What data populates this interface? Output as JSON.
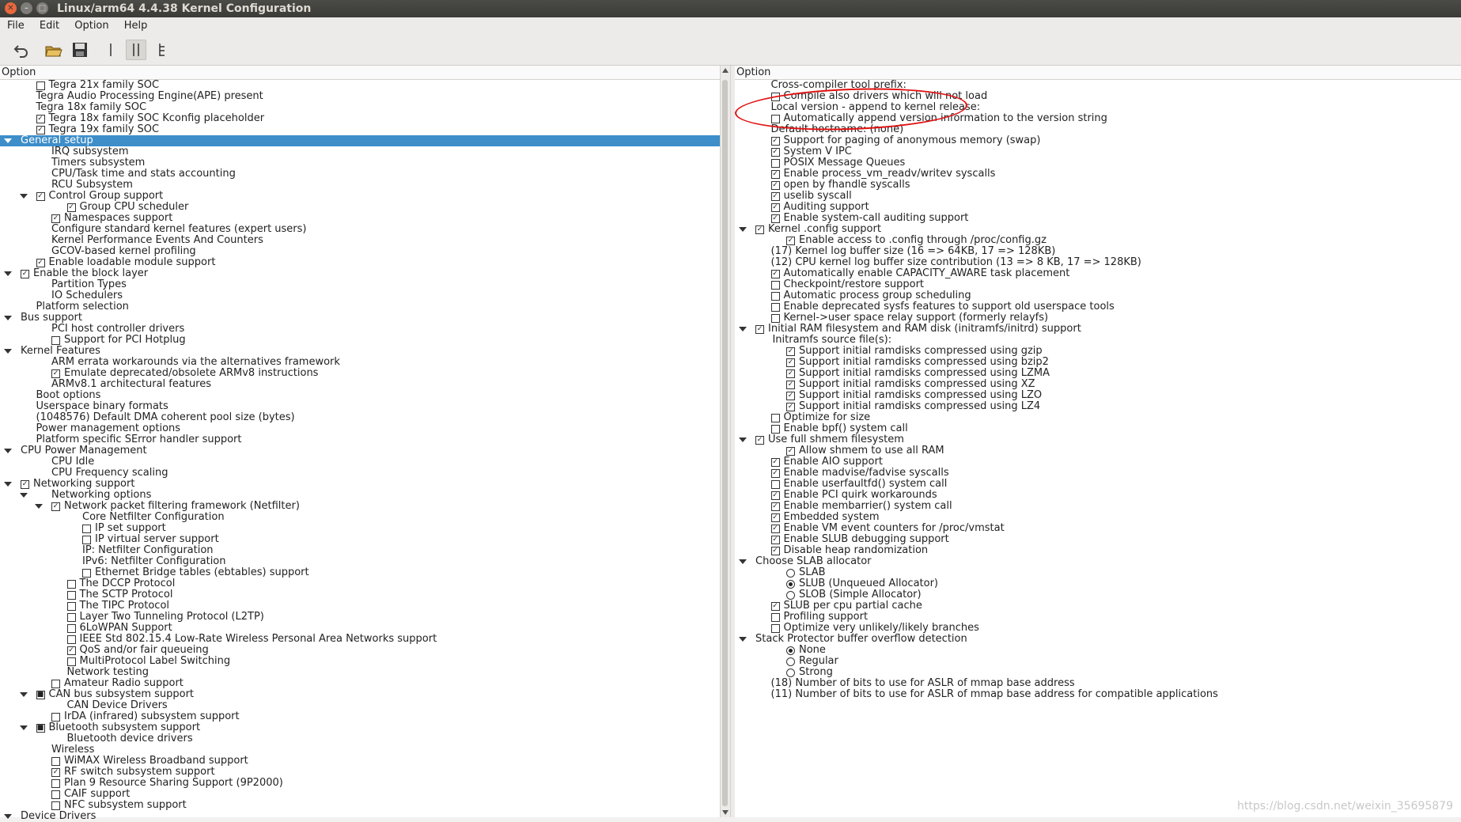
{
  "window": {
    "title": "Linux/arm64 4.4.38 Kernel Configuration",
    "buttons": [
      "close",
      "minimize",
      "maximize"
    ]
  },
  "menubar": [
    "File",
    "Edit",
    "Option",
    "Help"
  ],
  "toolbar": [
    "undo-icon",
    "open-folder-icon",
    "save-icon",
    "single-view-icon",
    "split-view-icon",
    "full-tree-view-icon"
  ],
  "left_pane": {
    "header": "Option",
    "rows": [
      {
        "indent": 1,
        "control": "checkbox",
        "checked": false,
        "label": "Tegra 21x family SOC"
      },
      {
        "indent": 1,
        "control": "none",
        "label": "Tegra Audio Processing Engine(APE) present"
      },
      {
        "indent": 1,
        "control": "none",
        "label": "Tegra 18x family SOC"
      },
      {
        "indent": 1,
        "control": "checkbox",
        "checked": true,
        "label": "Tegra 18x family SOC Kconfig placeholder"
      },
      {
        "indent": 1,
        "control": "checkbox",
        "checked": true,
        "label": "Tegra 19x family SOC"
      },
      {
        "indent": 0,
        "arrow": true,
        "control": "none",
        "label": "General setup",
        "selected": true
      },
      {
        "indent": 2,
        "control": "none",
        "label": "IRQ subsystem"
      },
      {
        "indent": 2,
        "control": "none",
        "label": "Timers subsystem"
      },
      {
        "indent": 2,
        "control": "none",
        "label": "CPU/Task time and stats accounting"
      },
      {
        "indent": 2,
        "control": "none",
        "label": "RCU Subsystem"
      },
      {
        "indent": 1,
        "arrow": true,
        "control": "checkbox",
        "checked": true,
        "label": "Control Group support"
      },
      {
        "indent": 3,
        "control": "checkbox",
        "checked": true,
        "label": "Group CPU scheduler"
      },
      {
        "indent": 2,
        "control": "checkbox",
        "checked": true,
        "label": "Namespaces support"
      },
      {
        "indent": 2,
        "control": "none",
        "label": "Configure standard kernel features (expert users)"
      },
      {
        "indent": 2,
        "control": "none",
        "label": "Kernel Performance Events And Counters"
      },
      {
        "indent": 2,
        "control": "none",
        "label": "GCOV-based kernel profiling"
      },
      {
        "indent": 1,
        "control": "checkbox",
        "checked": true,
        "label": "Enable loadable module support"
      },
      {
        "indent": 0,
        "arrow": true,
        "control": "checkbox",
        "checked": true,
        "label": "Enable the block layer"
      },
      {
        "indent": 2,
        "control": "none",
        "label": "Partition Types"
      },
      {
        "indent": 2,
        "control": "none",
        "label": "IO Schedulers"
      },
      {
        "indent": 1,
        "control": "none",
        "label": "Platform selection"
      },
      {
        "indent": 0,
        "arrow": true,
        "control": "none",
        "label": "Bus support"
      },
      {
        "indent": 2,
        "control": "none",
        "label": "PCI host controller drivers"
      },
      {
        "indent": 2,
        "control": "checkbox",
        "checked": false,
        "label": "Support for PCI Hotplug"
      },
      {
        "indent": 0,
        "arrow": true,
        "control": "none",
        "label": "Kernel Features"
      },
      {
        "indent": 2,
        "control": "none",
        "label": "ARM errata workarounds via the alternatives framework"
      },
      {
        "indent": 2,
        "control": "checkbox",
        "checked": true,
        "label": "Emulate deprecated/obsolete ARMv8 instructions"
      },
      {
        "indent": 2,
        "control": "none",
        "label": "ARMv8.1 architectural features"
      },
      {
        "indent": 1,
        "control": "none",
        "label": "Boot options"
      },
      {
        "indent": 1,
        "control": "none",
        "label": "Userspace binary formats"
      },
      {
        "indent": 1,
        "control": "none",
        "label": "(1048576) Default  DMA coherent pool size (bytes)"
      },
      {
        "indent": 1,
        "control": "none",
        "label": "Power management options"
      },
      {
        "indent": 1,
        "control": "none",
        "label": "Platform specific SError handler support"
      },
      {
        "indent": 0,
        "arrow": true,
        "control": "none",
        "label": "CPU Power Management"
      },
      {
        "indent": 2,
        "control": "none",
        "label": "CPU Idle"
      },
      {
        "indent": 2,
        "control": "none",
        "label": "CPU Frequency scaling"
      },
      {
        "indent": 0,
        "arrow": true,
        "control": "checkbox",
        "checked": true,
        "label": "Networking support"
      },
      {
        "indent": 1,
        "arrow": true,
        "control": "none",
        "label": "Networking options",
        "text_indent": 2
      },
      {
        "indent": 2,
        "arrow": true,
        "control": "checkbox",
        "checked": true,
        "label": "Network packet filtering framework (Netfilter)"
      },
      {
        "indent": 4,
        "control": "none",
        "label": "Core Netfilter Configuration"
      },
      {
        "indent": 4,
        "control": "checkbox",
        "checked": false,
        "label": "IP set support"
      },
      {
        "indent": 4,
        "control": "checkbox",
        "checked": false,
        "label": "IP virtual server support"
      },
      {
        "indent": 4,
        "control": "none",
        "label": "IP: Netfilter Configuration"
      },
      {
        "indent": 4,
        "control": "none",
        "label": "IPv6: Netfilter Configuration"
      },
      {
        "indent": 4,
        "control": "checkbox",
        "checked": false,
        "label": "Ethernet Bridge tables (ebtables) support"
      },
      {
        "indent": 3,
        "control": "checkbox",
        "checked": false,
        "label": "The DCCP Protocol"
      },
      {
        "indent": 3,
        "control": "checkbox",
        "checked": false,
        "label": "The SCTP Protocol"
      },
      {
        "indent": 3,
        "control": "checkbox",
        "checked": false,
        "label": "The TIPC Protocol"
      },
      {
        "indent": 3,
        "control": "checkbox",
        "checked": false,
        "label": "Layer Two Tunneling Protocol (L2TP)"
      },
      {
        "indent": 3,
        "control": "checkbox",
        "checked": false,
        "label": "6LoWPAN Support"
      },
      {
        "indent": 3,
        "control": "checkbox",
        "checked": false,
        "label": "IEEE Std 802.15.4 Low-Rate Wireless Personal Area Networks support"
      },
      {
        "indent": 3,
        "control": "checkbox",
        "checked": true,
        "label": "QoS and/or fair queueing"
      },
      {
        "indent": 3,
        "control": "checkbox",
        "checked": false,
        "label": "MultiProtocol Label Switching"
      },
      {
        "indent": 3,
        "control": "none",
        "label": "Network testing"
      },
      {
        "indent": 2,
        "control": "checkbox",
        "checked": false,
        "label": "Amateur Radio support"
      },
      {
        "indent": 1,
        "arrow": true,
        "control": "checkbox",
        "checked": "partial",
        "label": "CAN bus subsystem support"
      },
      {
        "indent": 3,
        "control": "none",
        "label": "CAN Device Drivers"
      },
      {
        "indent": 2,
        "control": "checkbox",
        "checked": false,
        "label": "IrDA (infrared) subsystem support"
      },
      {
        "indent": 1,
        "arrow": true,
        "control": "checkbox",
        "checked": "partial",
        "label": "Bluetooth subsystem support"
      },
      {
        "indent": 3,
        "control": "none",
        "label": "Bluetooth device drivers"
      },
      {
        "indent": 2,
        "control": "none",
        "label": "Wireless"
      },
      {
        "indent": 2,
        "control": "checkbox",
        "checked": false,
        "label": "WiMAX Wireless Broadband support"
      },
      {
        "indent": 2,
        "control": "checkbox",
        "checked": true,
        "label": "RF switch subsystem support"
      },
      {
        "indent": 2,
        "control": "checkbox",
        "checked": false,
        "label": "Plan 9 Resource Sharing Support (9P2000)"
      },
      {
        "indent": 2,
        "control": "checkbox",
        "checked": false,
        "label": "CAIF support"
      },
      {
        "indent": 2,
        "control": "checkbox",
        "checked": false,
        "label": "NFC subsystem support"
      },
      {
        "indent": 0,
        "arrow": true,
        "control": "none",
        "label": "Device Drivers"
      }
    ]
  },
  "right_pane": {
    "header": "Option",
    "rows": [
      {
        "indent": 1,
        "control": "none",
        "label": "Cross-compiler tool prefix:"
      },
      {
        "indent": 1,
        "control": "checkbox",
        "checked": false,
        "label": "Compile also drivers which will not load"
      },
      {
        "indent": 1,
        "control": "none",
        "label": "Local version - append to kernel release:"
      },
      {
        "indent": 1,
        "control": "checkbox",
        "checked": false,
        "label": "Automatically append version information to the version string"
      },
      {
        "indent": 1,
        "control": "none",
        "label": "Default hostname: (none)"
      },
      {
        "indent": 1,
        "control": "checkbox",
        "checked": true,
        "label": "Support for paging of anonymous memory (swap)"
      },
      {
        "indent": 1,
        "control": "checkbox",
        "checked": true,
        "label": "System V IPC"
      },
      {
        "indent": 1,
        "control": "checkbox",
        "checked": false,
        "label": "POSIX Message Queues"
      },
      {
        "indent": 1,
        "control": "checkbox",
        "checked": true,
        "label": "Enable process_vm_readv/writev syscalls"
      },
      {
        "indent": 1,
        "control": "checkbox",
        "checked": true,
        "label": "open by fhandle syscalls"
      },
      {
        "indent": 1,
        "control": "checkbox",
        "checked": true,
        "label": "uselib syscall"
      },
      {
        "indent": 1,
        "control": "checkbox",
        "checked": true,
        "label": "Auditing support"
      },
      {
        "indent": 1,
        "control": "checkbox",
        "checked": true,
        "label": "Enable system-call auditing support"
      },
      {
        "indent": 0,
        "arrow": true,
        "control": "checkbox",
        "checked": true,
        "label": "Kernel .config support"
      },
      {
        "indent": 2,
        "control": "checkbox",
        "checked": true,
        "label": "Enable access to .config through /proc/config.gz"
      },
      {
        "indent": 1,
        "control": "none",
        "label": "(17) Kernel log buffer size (16 => 64KB, 17 => 128KB)"
      },
      {
        "indent": 1,
        "control": "none",
        "label": "(12) CPU kernel log buffer size contribution (13 => 8 KB, 17 => 128KB)"
      },
      {
        "indent": 1,
        "control": "checkbox",
        "checked": true,
        "label": "Automatically enable CAPACITY_AWARE task placement"
      },
      {
        "indent": 1,
        "control": "checkbox",
        "checked": false,
        "label": "Checkpoint/restore support"
      },
      {
        "indent": 1,
        "control": "checkbox",
        "checked": false,
        "label": "Automatic process group scheduling"
      },
      {
        "indent": 1,
        "control": "checkbox",
        "checked": false,
        "label": "Enable deprecated sysfs features to support old userspace tools"
      },
      {
        "indent": 1,
        "control": "checkbox",
        "checked": false,
        "label": "Kernel->user space relay support (formerly relayfs)"
      },
      {
        "indent": 0,
        "arrow": true,
        "control": "checkbox",
        "checked": true,
        "label": "Initial RAM filesystem and RAM disk (initramfs/initrd) support"
      },
      {
        "indent": 2,
        "control": "none",
        "label": "Initramfs source file(s):",
        "text_indent": 1.1
      },
      {
        "indent": 2,
        "control": "checkbox",
        "checked": true,
        "label": "Support initial ramdisks compressed using gzip"
      },
      {
        "indent": 2,
        "control": "checkbox",
        "checked": true,
        "label": "Support initial ramdisks compressed using bzip2"
      },
      {
        "indent": 2,
        "control": "checkbox",
        "checked": true,
        "label": "Support initial ramdisks compressed using LZMA"
      },
      {
        "indent": 2,
        "control": "checkbox",
        "checked": true,
        "label": "Support initial ramdisks compressed using XZ"
      },
      {
        "indent": 2,
        "control": "checkbox",
        "checked": true,
        "label": "Support initial ramdisks compressed using LZO"
      },
      {
        "indent": 2,
        "control": "checkbox",
        "checked": true,
        "label": "Support initial ramdisks compressed using LZ4"
      },
      {
        "indent": 1,
        "control": "checkbox",
        "checked": false,
        "label": "Optimize for size"
      },
      {
        "indent": 1,
        "control": "checkbox",
        "checked": false,
        "label": "Enable bpf() system call"
      },
      {
        "indent": 0,
        "arrow": true,
        "control": "checkbox",
        "checked": true,
        "label": "Use full shmem filesystem"
      },
      {
        "indent": 2,
        "control": "checkbox",
        "checked": true,
        "label": "Allow shmem to use all RAM"
      },
      {
        "indent": 1,
        "control": "checkbox",
        "checked": true,
        "label": "Enable AIO support"
      },
      {
        "indent": 1,
        "control": "checkbox",
        "checked": true,
        "label": "Enable madvise/fadvise syscalls"
      },
      {
        "indent": 1,
        "control": "checkbox",
        "checked": false,
        "label": "Enable userfaultfd() system call"
      },
      {
        "indent": 1,
        "control": "checkbox",
        "checked": true,
        "label": "Enable PCI quirk workarounds"
      },
      {
        "indent": 1,
        "control": "checkbox",
        "checked": true,
        "label": "Enable membarrier() system call"
      },
      {
        "indent": 1,
        "control": "checkbox",
        "checked": true,
        "label": "Embedded system"
      },
      {
        "indent": 1,
        "control": "checkbox",
        "checked": true,
        "label": "Enable VM event counters for /proc/vmstat"
      },
      {
        "indent": 1,
        "control": "checkbox",
        "checked": true,
        "label": "Enable SLUB debugging support"
      },
      {
        "indent": 1,
        "control": "checkbox",
        "checked": true,
        "label": "Disable heap randomization"
      },
      {
        "indent": 0,
        "arrow": true,
        "control": "none",
        "label": "Choose SLAB allocator"
      },
      {
        "indent": 2,
        "control": "radio",
        "checked": false,
        "label": "SLAB"
      },
      {
        "indent": 2,
        "control": "radio",
        "checked": true,
        "label": "SLUB (Unqueued Allocator)"
      },
      {
        "indent": 2,
        "control": "radio",
        "checked": false,
        "label": "SLOB (Simple Allocator)"
      },
      {
        "indent": 1,
        "control": "checkbox",
        "checked": true,
        "label": "SLUB per cpu partial cache"
      },
      {
        "indent": 1,
        "control": "checkbox",
        "checked": false,
        "label": "Profiling support"
      },
      {
        "indent": 1,
        "control": "checkbox",
        "checked": false,
        "label": "Optimize very unlikely/likely branches"
      },
      {
        "indent": 0,
        "arrow": true,
        "control": "none",
        "label": "Stack Protector buffer overflow detection"
      },
      {
        "indent": 2,
        "control": "radio",
        "checked": true,
        "label": "None"
      },
      {
        "indent": 2,
        "control": "radio",
        "checked": false,
        "label": "Regular"
      },
      {
        "indent": 2,
        "control": "radio",
        "checked": false,
        "label": "Strong"
      },
      {
        "indent": 1,
        "control": "none",
        "label": "(18) Number of bits to use for ASLR of mmap base address"
      },
      {
        "indent": 1,
        "control": "none",
        "label": "(11) Number of bits to use for ASLR of mmap base address for compatible applications"
      }
    ]
  },
  "annotation": {
    "type": "red-circle",
    "color": "#e01010"
  },
  "watermark": "https://blog.csdn.net/weixin_35695879"
}
